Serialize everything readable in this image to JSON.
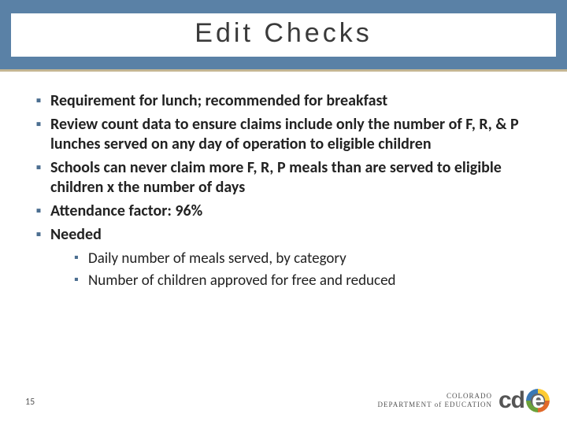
{
  "title": "Edit Checks",
  "bullets": {
    "lvl1": [
      "Requirement for lunch; recommended for breakfast",
      "Review count data to ensure claims include only the number of F, R, & P lunches served on any day of operation to eligible children",
      "Schools can never claim more F, R, P meals than are served to eligible children x the number of days",
      "Attendance factor: 96%",
      "Needed"
    ],
    "lvl2": [
      "Daily number of meals served, by category",
      "Number of children approved for free and reduced"
    ]
  },
  "page_number": "15",
  "footer": {
    "state": "COLORADO",
    "dept_line": "DEPARTMENT of EDUCATION",
    "logo_text_cd": "cd",
    "logo_text_e": "e"
  }
}
